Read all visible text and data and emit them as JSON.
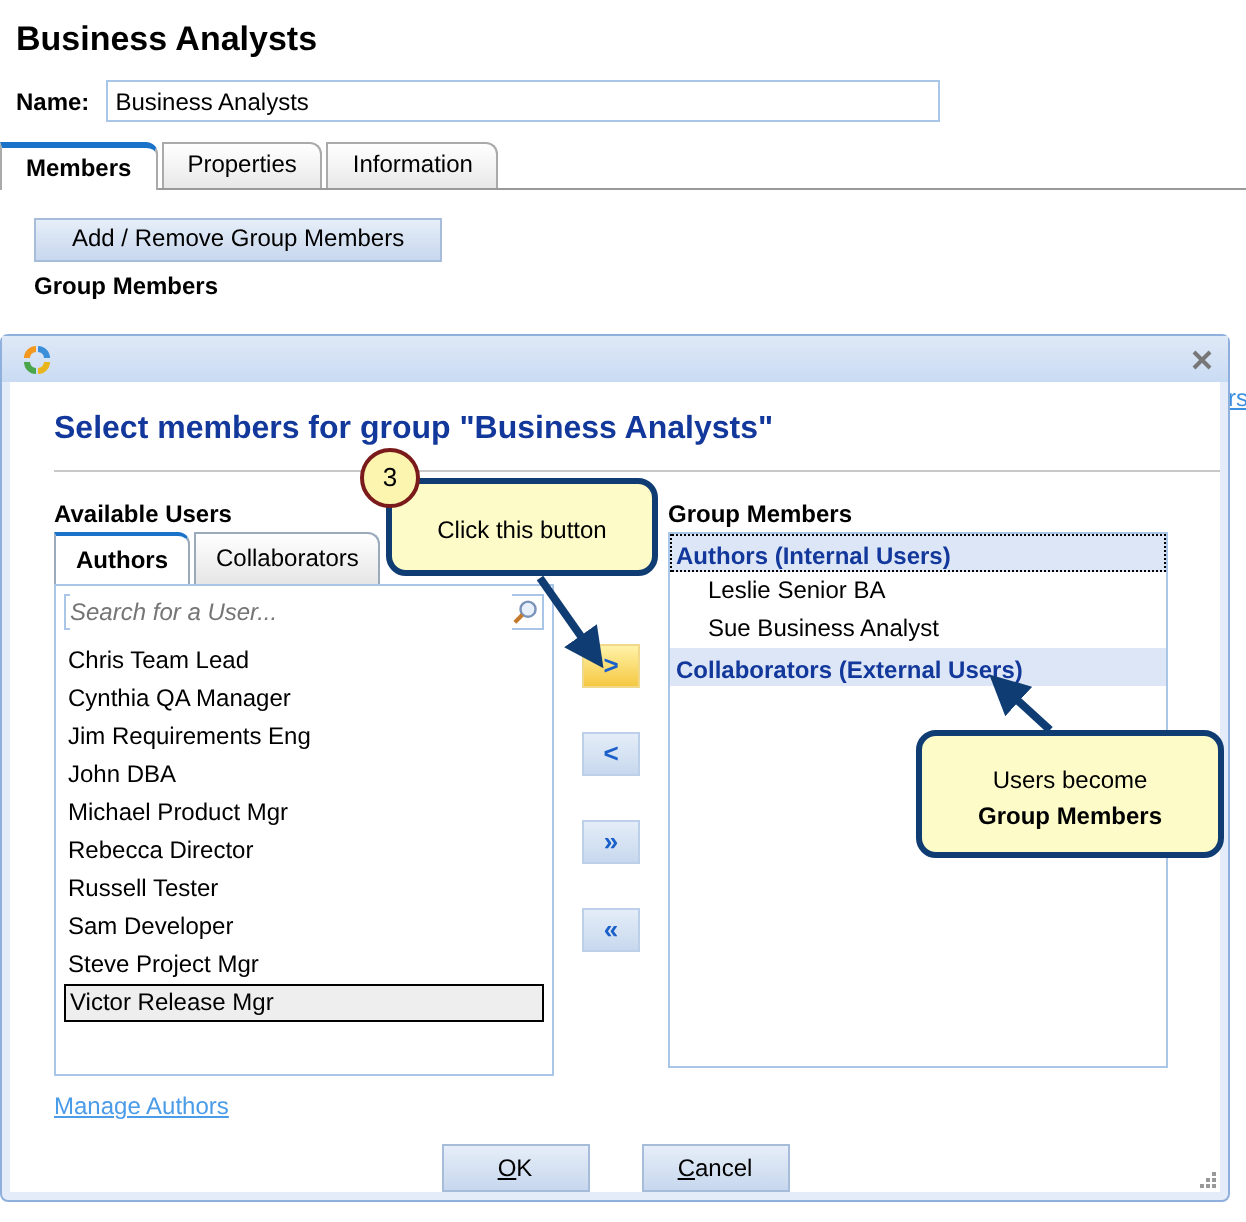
{
  "page": {
    "title": "Business Analysts",
    "name_label": "Name:",
    "name_value": "Business Analysts",
    "tabs": [
      {
        "label": "Members",
        "selected": true
      },
      {
        "label": "Properties",
        "selected": false
      },
      {
        "label": "Information",
        "selected": false
      }
    ],
    "add_button": "Add / Remove Group Members",
    "section_heading": "Group Members",
    "edge_link": "rs"
  },
  "dialog": {
    "title": "Select members for group \"Business Analysts\"",
    "available_label": "Available Users",
    "user_tabs": [
      {
        "label": "Authors",
        "selected": true
      },
      {
        "label": "Collaborators",
        "selected": false
      }
    ],
    "search": {
      "placeholder": "Search for a User..."
    },
    "users": [
      {
        "name": "Chris Team Lead",
        "selected": false
      },
      {
        "name": "Cynthia QA Manager",
        "selected": false
      },
      {
        "name": "Jim Requirements Eng",
        "selected": false
      },
      {
        "name": "John DBA",
        "selected": false
      },
      {
        "name": "Michael Product Mgr",
        "selected": false
      },
      {
        "name": "Rebecca Director",
        "selected": false
      },
      {
        "name": "Russell Tester",
        "selected": false
      },
      {
        "name": "Sam Developer",
        "selected": false
      },
      {
        "name": "Steve Project Mgr",
        "selected": false
      },
      {
        "name": "Victor Release Mgr",
        "selected": true
      }
    ],
    "move_buttons": [
      {
        "glyph": ">",
        "highlighted": true
      },
      {
        "glyph": "<",
        "highlighted": false
      },
      {
        "glyph": "»",
        "highlighted": false
      },
      {
        "glyph": "«",
        "highlighted": false
      }
    ],
    "members_label": "Group Members",
    "member_groups": [
      {
        "name": "Authors (Internal Users)",
        "selected": true,
        "children": [
          {
            "name": "Leslie Senior BA"
          },
          {
            "name": "Sue Business Analyst"
          }
        ]
      },
      {
        "name": "Collaborators (External Users)",
        "selected": false
      }
    ],
    "manage_link": "Manage Authors",
    "buttons": [
      "OK",
      "Cancel"
    ]
  },
  "callouts": [
    {
      "step": "3",
      "lines": [
        {
          "text": "Click this button",
          "bold": false
        }
      ]
    },
    {
      "lines": [
        {
          "text": "Users become",
          "bold": false
        },
        {
          "text": "Group Members",
          "bold": true
        }
      ]
    }
  ]
}
